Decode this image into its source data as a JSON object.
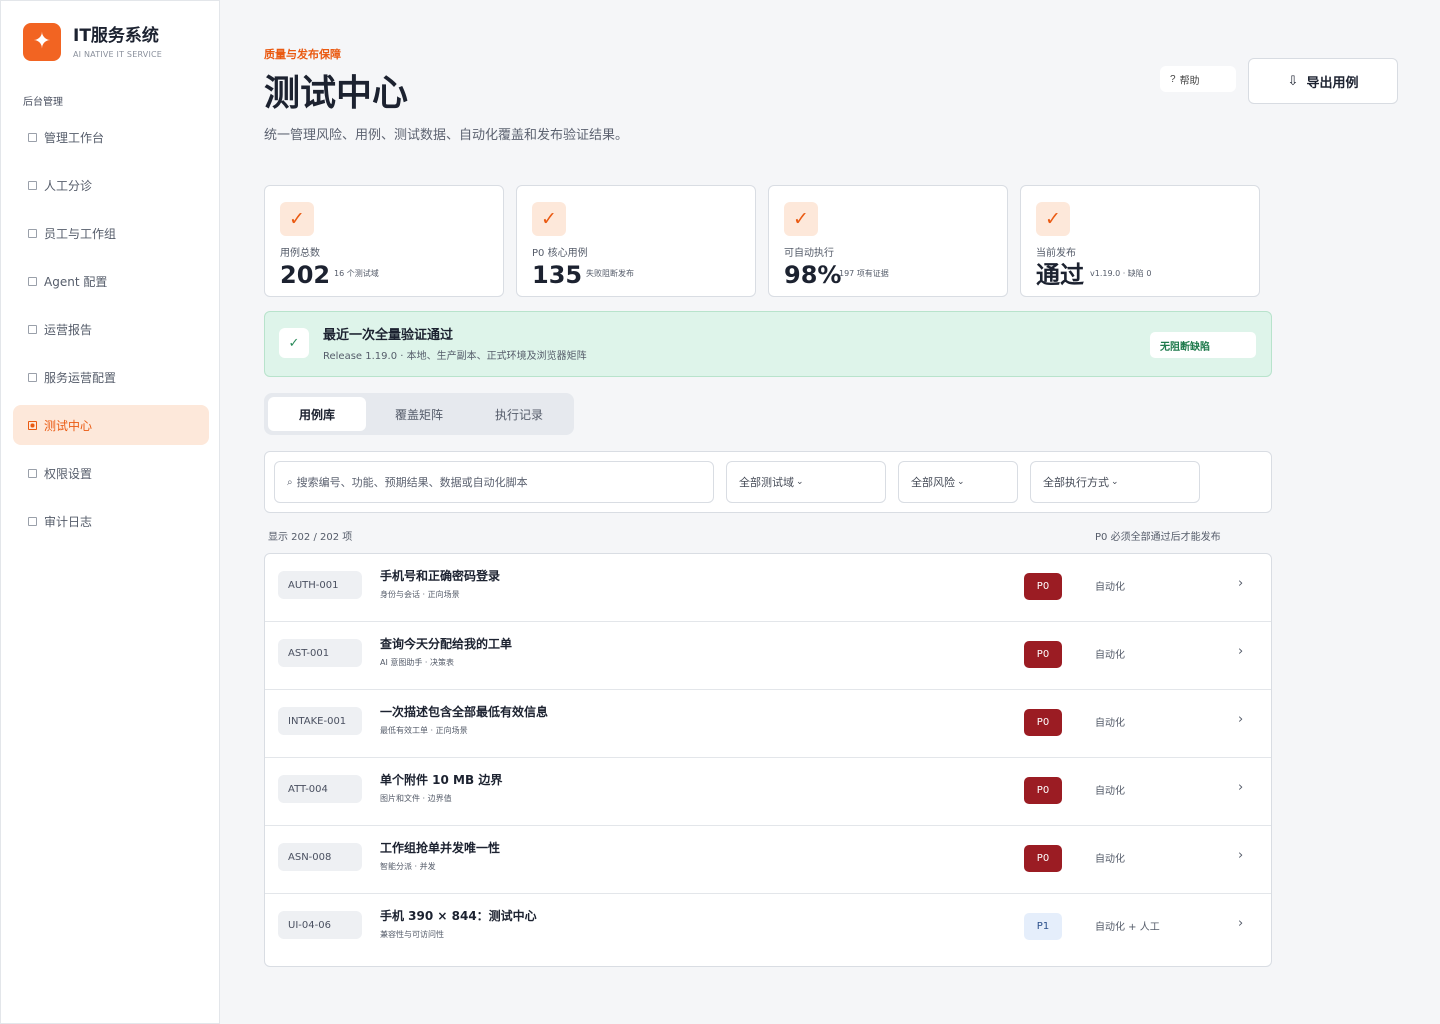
{
  "brand": {
    "logo_glyph": "✦",
    "title": "IT服务系统",
    "subtitle": "AI NATIVE IT SERVICE",
    "color": "#f26422"
  },
  "sidebar": {
    "section_label": "后台管理",
    "items": [
      {
        "label": "管理工作台",
        "active": false
      },
      {
        "label": "人工分诊",
        "active": false
      },
      {
        "label": "员工与工作组",
        "active": false
      },
      {
        "label": "Agent 配置",
        "active": false
      },
      {
        "label": "运营报告",
        "active": false
      },
      {
        "label": "服务运营配置",
        "active": false
      },
      {
        "label": "测试中心",
        "active": true
      },
      {
        "label": "权限设置",
        "active": false
      },
      {
        "label": "审计日志",
        "active": false
      }
    ]
  },
  "header": {
    "eyebrow": "质量与发布保障",
    "title": "测试中心",
    "description": "统一管理风险、用例、测试数据、自动化覆盖和发布验证结果。",
    "help_icon": "?",
    "help_label": "帮助",
    "export_icon": "⇩",
    "export_label": "导出用例"
  },
  "stats": [
    {
      "icon": "✓",
      "label": "用例总数",
      "value": "202",
      "note": "16 个测试域"
    },
    {
      "icon": "✓",
      "label": "P0 核心用例",
      "value": "135",
      "note": "失败阻断发布"
    },
    {
      "icon": "✓",
      "label": "可自动执行",
      "value": "98%",
      "note": "197 项有证据"
    },
    {
      "icon": "✓",
      "label": "当前发布",
      "value": "通过",
      "note": "v1.19.0 · 缺陷 0"
    }
  ],
  "banner": {
    "icon": "✓",
    "title": "最近一次全量验证通过",
    "subtitle": "Release 1.19.0 · 本地、生产副本、正式环境及浏览器矩阵",
    "badge": "无阻断缺陷"
  },
  "tabs": [
    {
      "label": "用例库",
      "active": true
    },
    {
      "label": "覆盖矩阵",
      "active": false
    },
    {
      "label": "执行记录",
      "active": false
    }
  ],
  "filters": {
    "search_icon": "⌕",
    "search_placeholder": "搜索编号、功能、预期结果、数据或自动化脚本",
    "domain_select": "全部测试域",
    "risk_select": "全部风险",
    "mode_select": "全部执行方式",
    "chevron": "⌄"
  },
  "list_meta": {
    "count": "显示 202 / 202 项",
    "hint": "P0 必须全部通过后才能发布"
  },
  "cases": [
    {
      "code": "AUTH-001",
      "title": "手机号和正确密码登录",
      "sub": "身份与会话 · 正向场景",
      "priority": "P0",
      "mode": "自动化"
    },
    {
      "code": "AST-001",
      "title": "查询今天分配给我的工单",
      "sub": "AI 意图助手 · 决策表",
      "priority": "P0",
      "mode": "自动化"
    },
    {
      "code": "INTAKE-001",
      "title": "一次描述包含全部最低有效信息",
      "sub": "最低有效工单 · 正向场景",
      "priority": "P0",
      "mode": "自动化"
    },
    {
      "code": "ATT-004",
      "title": "单个附件 10 MB 边界",
      "sub": "图片和文件 · 边界值",
      "priority": "P0",
      "mode": "自动化"
    },
    {
      "code": "ASN-008",
      "title": "工作组抢单并发唯一性",
      "sub": "智能分派 · 并发",
      "priority": "P0",
      "mode": "自动化"
    },
    {
      "code": "UI-04-06",
      "title": "手机 390 × 844：测试中心",
      "sub": "兼容性与可访问性",
      "priority": "P1",
      "mode": "自动化 + 人工"
    }
  ],
  "row_arrow": "›",
  "colors": {
    "accent": "#ea5a12",
    "p0": "#9b1c23",
    "p1_bg": "#e5eefb",
    "success_bg": "#def4ea"
  }
}
